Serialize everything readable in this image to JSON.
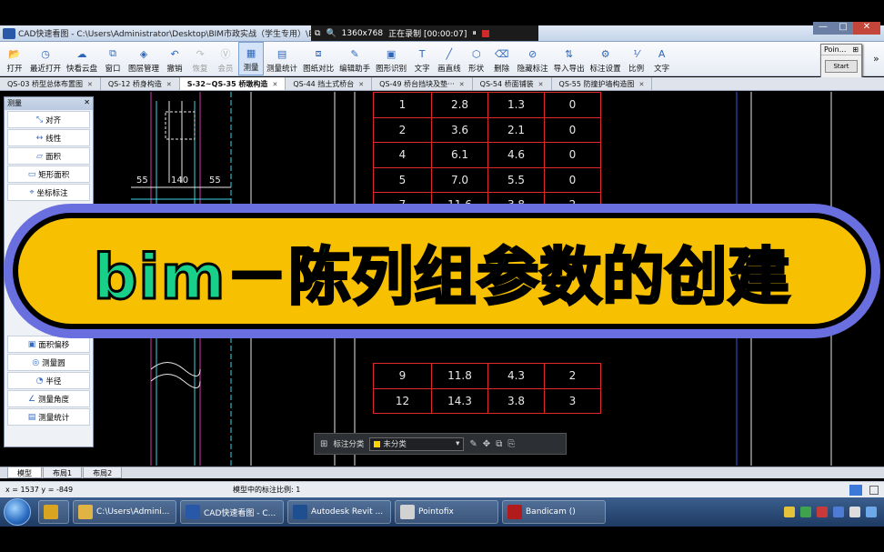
{
  "window": {
    "title": "CAD快速看图 - C:\\Users\\Administrator\\Desktop\\BIM市政实战（学生专用）\\BIM",
    "controls": [
      "—",
      "□",
      "✕"
    ]
  },
  "recorder": {
    "resolution": "1360x768",
    "status": "正在录制 [00:00:07]"
  },
  "toolbar": {
    "items": [
      {
        "label": "打开",
        "icon": "folder-icon",
        "glyph": "📂"
      },
      {
        "label": "最近打开",
        "icon": "clock-icon",
        "glyph": "◷"
      },
      {
        "label": "快看云盘",
        "icon": "cloud-icon",
        "glyph": "☁"
      },
      {
        "label": "窗口",
        "icon": "window-icon",
        "glyph": "⧉"
      },
      {
        "label": "图层管理",
        "icon": "layers-icon",
        "glyph": "◈"
      },
      {
        "label": "撤销",
        "icon": "undo-icon",
        "glyph": "↶"
      },
      {
        "label": "恢复",
        "icon": "redo-icon",
        "glyph": "↷",
        "disabled": true
      },
      {
        "label": "会员",
        "icon": "vip-icon",
        "glyph": "Ⓥ",
        "disabled": true
      },
      {
        "label": "测量",
        "icon": "measure-icon",
        "glyph": "▦",
        "active": true
      },
      {
        "label": "测量统计",
        "icon": "measure-stats-icon",
        "glyph": "▤"
      },
      {
        "label": "图纸对比",
        "icon": "compare-icon",
        "glyph": "⧈"
      },
      {
        "label": "编辑助手",
        "icon": "edit-helper-icon",
        "glyph": "✎"
      },
      {
        "label": "图形识别",
        "icon": "shape-recognize-icon",
        "glyph": "▣"
      },
      {
        "label": "文字",
        "icon": "text-icon",
        "glyph": "T"
      },
      {
        "label": "画直线",
        "icon": "line-icon",
        "glyph": "╱"
      },
      {
        "label": "形状",
        "icon": "shape-icon",
        "glyph": "⬡"
      },
      {
        "label": "删除",
        "icon": "eraser-icon",
        "glyph": "⌫"
      },
      {
        "label": "隐藏标注",
        "icon": "hide-annotation-icon",
        "glyph": "⊘"
      },
      {
        "label": "导入导出",
        "icon": "import-export-icon",
        "glyph": "⇅"
      },
      {
        "label": "标注设置",
        "icon": "annotation-settings-icon",
        "glyph": "⚙"
      },
      {
        "label": "比例",
        "icon": "scale-icon",
        "glyph": "⅟"
      },
      {
        "label": "文字",
        "icon": "text-icon-2",
        "glyph": "A"
      }
    ],
    "more": "»"
  },
  "point_popup": {
    "title": "Poin...",
    "button": "Start"
  },
  "tabs": [
    {
      "label": "QS-03 桥型总体布置图",
      "active": false
    },
    {
      "label": "QS-12 桥身构造",
      "active": false
    },
    {
      "label": "S-32~QS-35 桥墩构造",
      "active": true
    },
    {
      "label": "QS-44 挡土式桥台",
      "active": false
    },
    {
      "label": "QS-49 桥台挡块及垫···",
      "active": false
    },
    {
      "label": "QS-54 桥面铺装",
      "active": false
    },
    {
      "label": "QS-55 防撞护墙构造图",
      "active": false
    }
  ],
  "side_panel": {
    "title": "测量",
    "items_top": [
      {
        "label": "对齐",
        "glyph": "⤡"
      },
      {
        "label": "线性",
        "glyph": "↔"
      },
      {
        "label": "面积",
        "glyph": "▱"
      },
      {
        "label": "矩形面积",
        "glyph": "▭"
      },
      {
        "label": "坐标标注",
        "glyph": "⌖"
      }
    ],
    "items_bottom": [
      {
        "label": "面积偏移",
        "glyph": "▣"
      },
      {
        "label": "测量圆",
        "glyph": "◎"
      },
      {
        "label": "半径",
        "glyph": "◔"
      },
      {
        "label": "测量角度",
        "glyph": "∠"
      },
      {
        "label": "测量统计",
        "glyph": "▤"
      }
    ]
  },
  "drawing": {
    "dims": [
      "55",
      "140",
      "55"
    ],
    "table_rows": [
      [
        "1",
        "2.8",
        "1.3",
        "0"
      ],
      [
        "2",
        "3.6",
        "2.1",
        "0"
      ],
      [
        "4",
        "6.1",
        "4.6",
        "0"
      ],
      [
        "5",
        "7.0",
        "5.5",
        "0"
      ],
      [
        "7",
        "11.6",
        "3.8",
        "2"
      ]
    ],
    "table_rows_bottom": [
      [
        "9",
        "11.8",
        "4.3",
        "2"
      ],
      [
        "12",
        "14.3",
        "3.8",
        "3"
      ]
    ]
  },
  "float_bar": {
    "label": "标注分类",
    "select_value": "未分类"
  },
  "layout_tabs": [
    "模型",
    "布局1",
    "布局2"
  ],
  "statusbar": {
    "coords": "x = 1537  y = -849",
    "scale": "模型中的标注比例: 1"
  },
  "taskbar": {
    "items": [
      {
        "label": "",
        "color": "#d9a520"
      },
      {
        "label": "C:\\Users\\Admini...",
        "color": "#e0b444"
      },
      {
        "label": "CAD快速看图 - C...",
        "color": "#2a58a8"
      },
      {
        "label": "Autodesk Revit ...",
        "color": "#1d4f91"
      },
      {
        "label": "Pointofix",
        "color": "#d2d2d2"
      },
      {
        "label": "Bandicam ()",
        "color": "#b21b1b"
      }
    ]
  },
  "banner": {
    "text": "bim－陈列组参数的创建"
  }
}
